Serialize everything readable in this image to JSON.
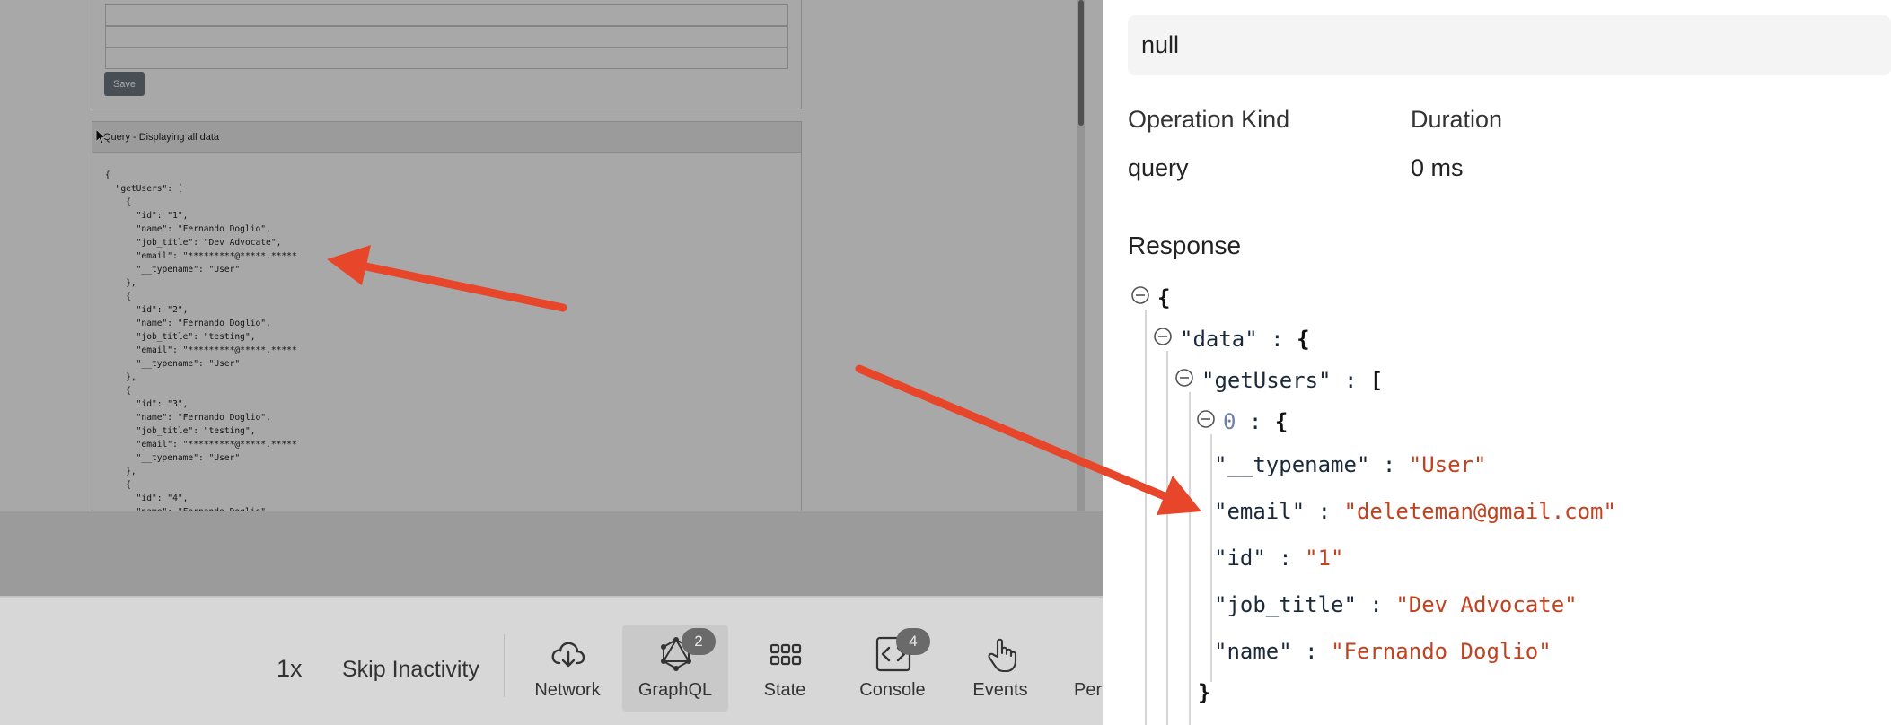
{
  "replay": {
    "save_label": "Save",
    "query_title": "Query - Displaying all data",
    "query_text": "{\n  \"getUsers\": [\n    {\n      \"id\": \"1\",\n      \"name\": \"Fernando Doglio\",\n      \"job_title\": \"Dev Advocate\",\n      \"email\": \"*********@*****.*****\n      \"__typename\": \"User\"\n    },\n    {\n      \"id\": \"2\",\n      \"name\": \"Fernando Doglio\",\n      \"job_title\": \"testing\",\n      \"email\": \"*********@*****.*****\n      \"__typename\": \"User\"\n    },\n    {\n      \"id\": \"3\",\n      \"name\": \"Fernando Doglio\",\n      \"job_title\": \"testing\",\n      \"email\": \"*********@*****.*****\n      \"__typename\": \"User\"\n    },\n    {\n      \"id\": \"4\",\n      \"name\": \"Fernando Doglio\","
  },
  "toolbar": {
    "speed": "1x",
    "skip_inactivity": "Skip Inactivity",
    "buttons": [
      {
        "label": "Network",
        "icon": "cloud-download-icon",
        "badge": ""
      },
      {
        "label": "GraphQL",
        "icon": "graphql-icon",
        "badge": "2"
      },
      {
        "label": "State",
        "icon": "grid-icon",
        "badge": ""
      },
      {
        "label": "Console",
        "icon": "code-icon",
        "badge": "4"
      },
      {
        "label": "Events",
        "icon": "pointer-icon",
        "badge": ""
      },
      {
        "label": "Per",
        "icon": "",
        "badge": ""
      }
    ]
  },
  "panel": {
    "variables_value": "null",
    "operation_kind_label": "Operation Kind",
    "operation_kind_value": "query",
    "duration_label": "Duration",
    "duration_value": "0 ms",
    "response_title": "Response"
  },
  "response_tree": {
    "root_open": "{",
    "data_key": "\"data\"",
    "sep": " : ",
    "data_open": "{",
    "getusers_key": "\"getUsers\"",
    "getusers_open": "[",
    "item_index": "0",
    "item_open": "{",
    "fields": [
      {
        "key": "\"__typename\"",
        "value": "\"User\""
      },
      {
        "key": "\"email\"",
        "value": "\"deleteman@gmail.com\""
      },
      {
        "key": "\"id\"",
        "value": "\"1\""
      },
      {
        "key": "\"job_title\"",
        "value": "\"Dev Advocate\""
      },
      {
        "key": "\"name\"",
        "value": "\"Fernando Doglio\""
      }
    ],
    "item_close": "}"
  },
  "colors": {
    "arrow": "#e8462a",
    "json_string": "#c2411f",
    "json_index": "#6c7fa6"
  }
}
